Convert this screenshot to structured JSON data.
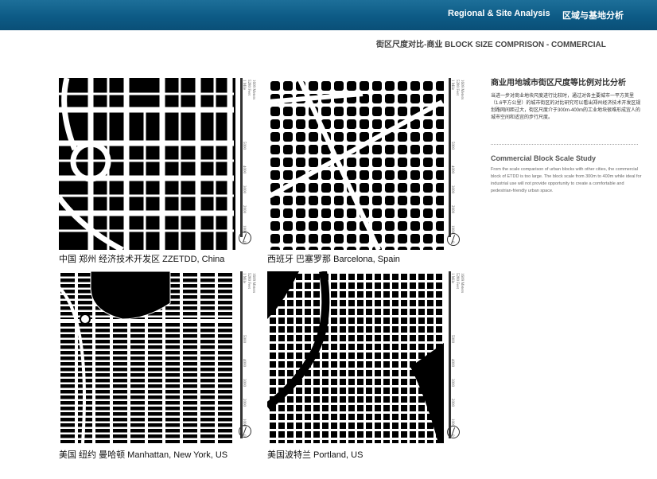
{
  "header": {
    "title_en": "Regional & Site Analysis",
    "title_cn": "区域与基地分析",
    "bg_color": "#0d5b86"
  },
  "subtitle": "街区尺度对比-商业 BLOCK SIZE COMPRISON - COMMERCIAL",
  "sidebar": {
    "heading_cn": "商业用地城市街区尺度等比例对比分析",
    "para_cn": "当进一步对商业地块尺度进行比较时，通过对各主要城市一平方英里（1.6平方公里）的城市街区的对比研究可以看出郑州经济技术开发区规划路网间距过大，街区尺度介于300m-400m的工业地块很难形成宜人的城市空间和适宜的步行尺度。",
    "heading_en": "Commercial Block Scale Study",
    "para_en": "From the scale comparison of urban blocks with other cities, the commercial block of ETDD is too large. The block scale from 300m to 400m while ideal for industrial use will not provide opportunity to create a comfortable and pedestrian-friendly urban space."
  },
  "maps": [
    {
      "caption": "中国 郑州 经济技术开发区 ZZETDD, China",
      "scale_labels": [
        "1 Mile",
        "5280 Feet",
        "1609 Meters",
        "5000",
        "4000",
        "3000",
        "2000",
        "1000",
        "0"
      ]
    },
    {
      "caption": "西班牙 巴塞罗那 Barcelona, Spain",
      "scale_labels": [
        "1 Mile",
        "5280 Feet",
        "1609 Meters",
        "5000",
        "4000",
        "3000",
        "2000",
        "1000",
        "0"
      ]
    },
    {
      "caption": "美国 纽约 曼哈顿 Manhattan, New York, US",
      "scale_labels": [
        "1 Mile",
        "5280 Feet",
        "1609 Meters",
        "5000",
        "4000",
        "3000",
        "2000",
        "1000",
        "0"
      ]
    },
    {
      "caption": "美国波特兰 Portland, US",
      "scale_labels": [
        "1 Mile",
        "5280 Feet",
        "1609 Meters",
        "5000",
        "4000",
        "3000",
        "2000",
        "1000",
        "0"
      ]
    }
  ]
}
